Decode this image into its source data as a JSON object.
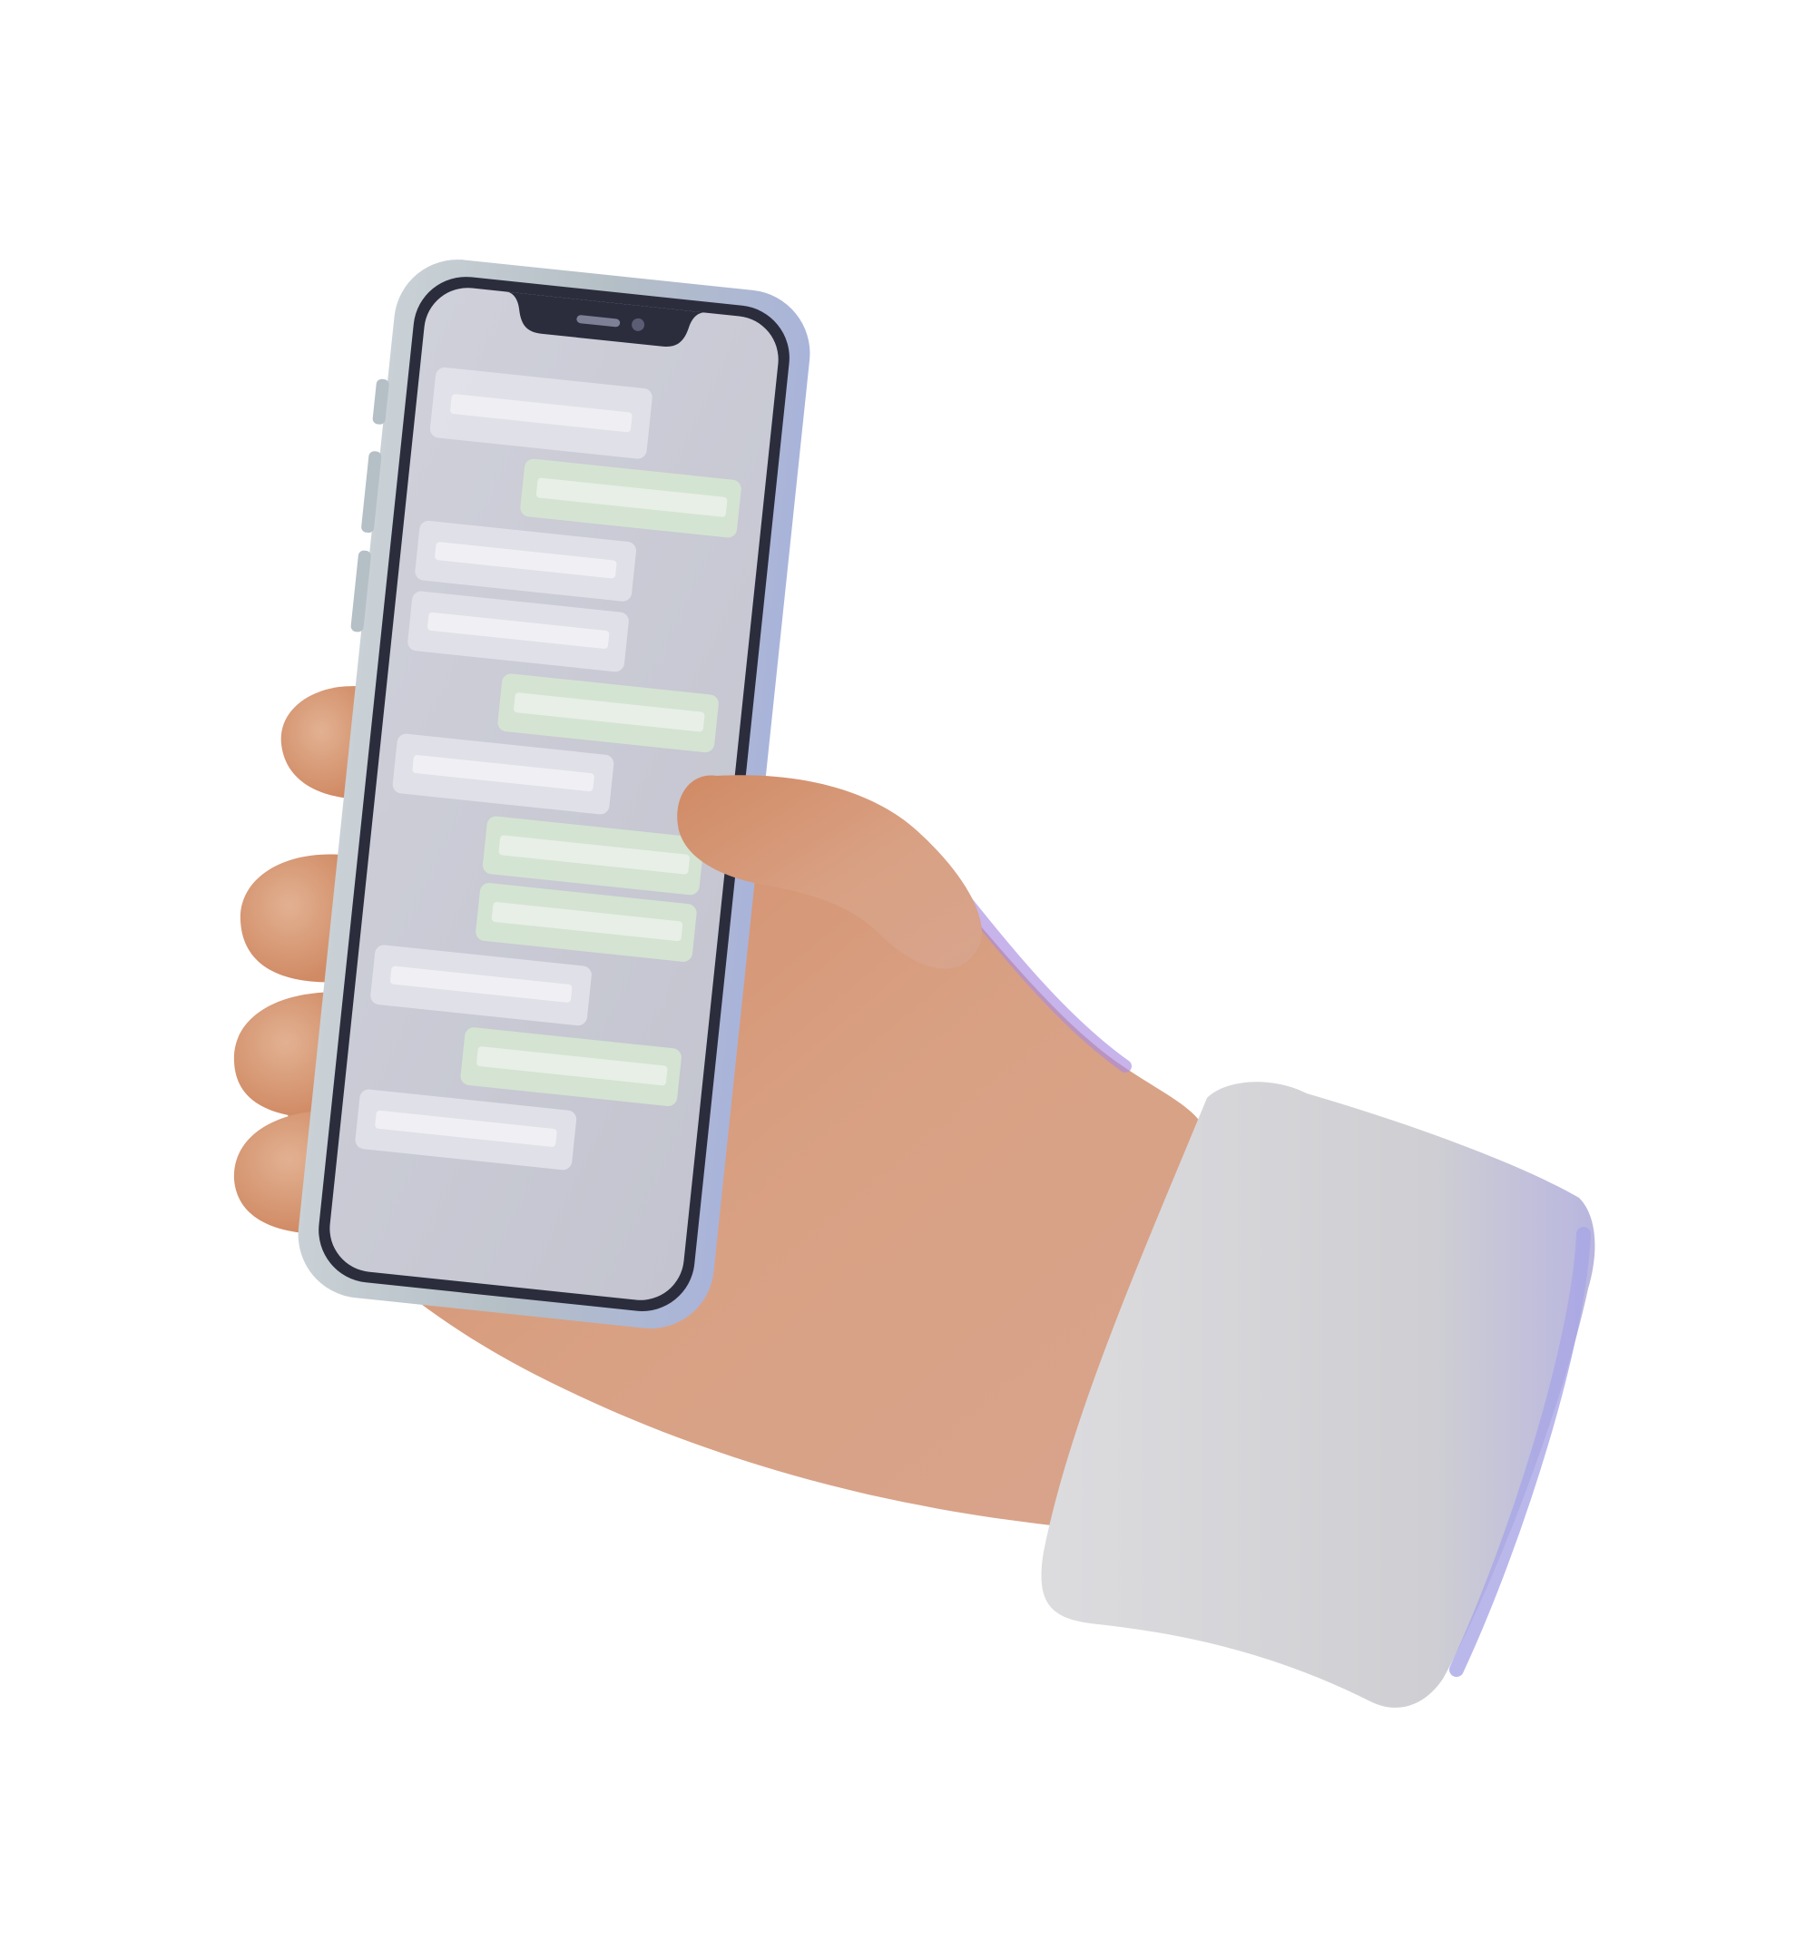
{
  "scene": {
    "subject": "hand-holding-phone",
    "colors": {
      "background": "#ffffff",
      "skin": "#d9a184",
      "skin_shadow": "#c98866",
      "rim_light": "#a98ce0",
      "sleeve": "#d2d2d6",
      "sleeve_rim": "#a9a6e6",
      "phone_frame": "#b9c3ca",
      "phone_bezel": "#2b2d3d",
      "screen": "#c6c8d6",
      "bubble_incoming": "#e8e8ee",
      "bubble_outgoing": "#d7e5d3"
    },
    "icons": [
      "speaker-icon",
      "camera-icon"
    ],
    "chat_bubbles": [
      {
        "side": "incoming"
      },
      {
        "side": "outgoing"
      },
      {
        "side": "incoming"
      },
      {
        "side": "incoming"
      },
      {
        "side": "outgoing"
      },
      {
        "side": "incoming"
      },
      {
        "side": "outgoing"
      },
      {
        "side": "outgoing"
      },
      {
        "side": "incoming"
      },
      {
        "side": "outgoing"
      },
      {
        "side": "incoming"
      }
    ]
  }
}
